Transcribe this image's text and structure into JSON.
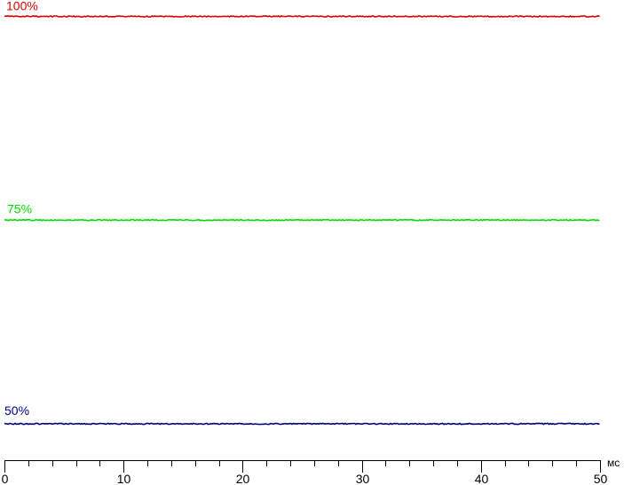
{
  "chart_data": {
    "type": "line",
    "x_unit": "мс",
    "xlim": [
      0,
      50
    ],
    "ylim": [
      0,
      100
    ],
    "x_ticks": [
      0,
      10,
      20,
      30,
      40,
      50
    ],
    "x_minor_step": 2,
    "series": [
      {
        "name": "100%",
        "color": "#dd0000",
        "x": [
          0,
          50
        ],
        "y": [
          100,
          100
        ]
      },
      {
        "name": "75%",
        "color": "#00dd00",
        "x": [
          0,
          50
        ],
        "y": [
          75,
          75
        ]
      },
      {
        "name": "50%",
        "color": "#000080",
        "x": [
          0,
          50
        ],
        "y": [
          50,
          50
        ]
      }
    ],
    "grid": false
  }
}
